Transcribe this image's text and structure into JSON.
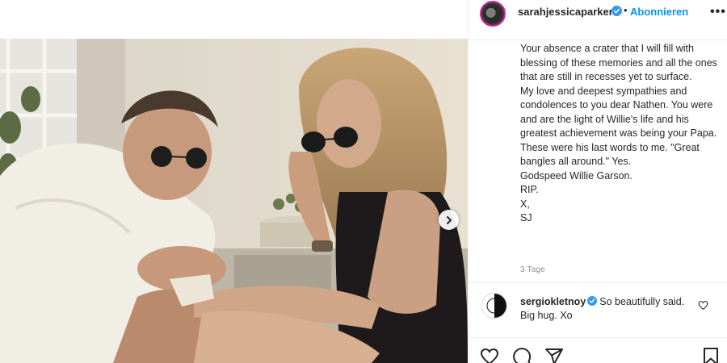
{
  "post": {
    "username": "sarahjessicaparker",
    "separator": "•",
    "follow_label": "Abonnieren",
    "more_icon": "more-options-icon",
    "more_glyph": "•••",
    "caption_lines": [
      "Your absence a crater that I will fill with blessing of these memories and all the ones that are still in recesses yet to surface.",
      "My love and deepest sympathies and condolences to you dear Nathen. You were and are the light of Willie's life and his greatest achievement was being your Papa.",
      "These were his last words to me. \"Great bangles all around.\" Yes.",
      "Godspeed Willie Garson.",
      "RIP.",
      "X,",
      "SJ"
    ],
    "timestamp": "3 Tage"
  },
  "comment": {
    "username": "sergiokletnoy",
    "text": "So beautifully said. Big hug. Xo"
  },
  "colors": {
    "accent": "#0095f6",
    "verified": "#3897f0",
    "text": "#262626",
    "muted": "#8e8e8e",
    "border": "#efefef"
  },
  "icons": [
    "verified-badge-icon",
    "chevron-right-icon",
    "heart-icon",
    "comment-icon",
    "share-icon",
    "bookmark-icon"
  ]
}
